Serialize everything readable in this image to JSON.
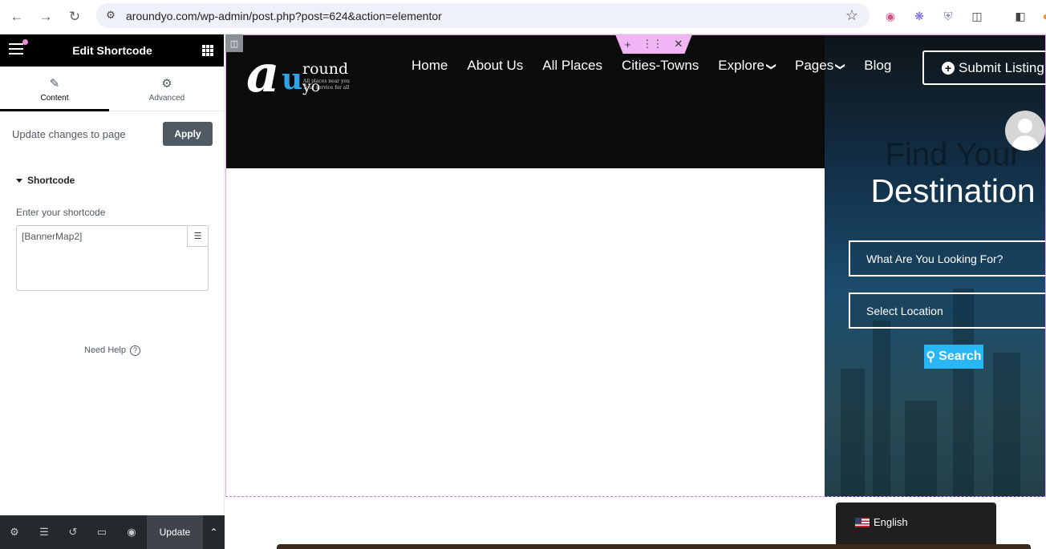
{
  "browser": {
    "url": "aroundyo.com/wp-admin/post.php?post=624&action=elementor"
  },
  "panel": {
    "title": "Edit Shortcode",
    "tabs": [
      {
        "label": "Content",
        "icon": "pencil-icon"
      },
      {
        "label": "Advanced",
        "icon": "gear-icon"
      }
    ],
    "apply_text": "Update changes to page",
    "apply_label": "Apply",
    "section_title": "Shortcode",
    "field_label": "Enter your shortcode",
    "shortcode_value": "[BannerMap2]",
    "need_help": "Need Help",
    "update_label": "Update"
  },
  "site": {
    "logo": {
      "letter_a": "a",
      "letter_u": "u",
      "rest": "round yo",
      "tagline_1": "All places near you",
      "tagline_2": "Your service for all"
    },
    "menu": [
      "Home",
      "About Us",
      "All Places",
      "Cities-Towns",
      "Explore",
      "Pages",
      "Blog"
    ],
    "submit_label": "Submit Listing",
    "hero": {
      "find": "Find Your",
      "destination": "Destination",
      "looking_placeholder": "What Are You Looking For?",
      "location_placeholder": "Select Location",
      "search_label": "Search"
    },
    "language": "English"
  },
  "colors": {
    "accent_search": "#29b6f6",
    "elementor_outline": "#e8a5f0",
    "panel_footer": "#26292c"
  }
}
